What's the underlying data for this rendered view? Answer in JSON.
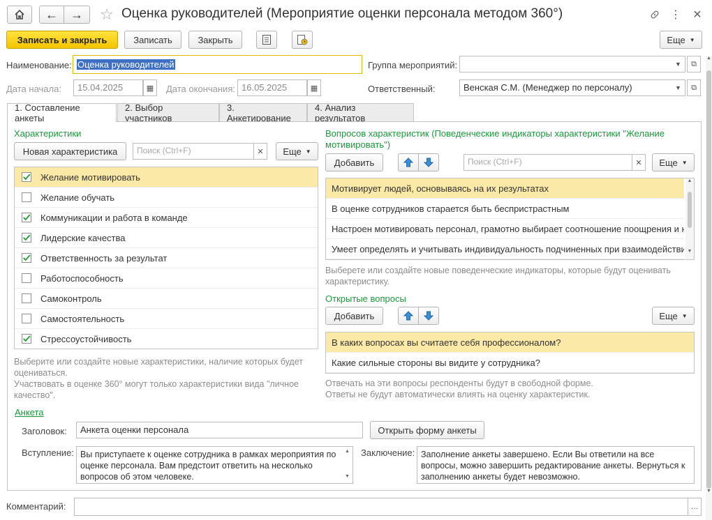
{
  "window": {
    "title": "Оценка руководителей (Мероприятие оценки персонала методом 360°)"
  },
  "toolbar": {
    "save_close": "Записать и закрыть",
    "save": "Записать",
    "close": "Закрыть",
    "more": "Еще"
  },
  "header": {
    "name_label": "Наименование:",
    "name_value": "Оценка руководителей",
    "group_label": "Группа мероприятий:",
    "group_value": "",
    "start_label": "Дата начала:",
    "start_value": "15.04.2025",
    "end_label": "Дата окончания:",
    "end_value": "16.05.2025",
    "resp_label": "Ответственный:",
    "resp_value": "Венская С.М. (Менеджер по персоналу)"
  },
  "tabs": [
    {
      "label": "1. Составление анкеты"
    },
    {
      "label": "2. Выбор участников"
    },
    {
      "label": "3. Анкетирование"
    },
    {
      "label": "4. Анализ результатов"
    }
  ],
  "chars": {
    "title": "Характеристики",
    "new_button": "Новая характеристика",
    "search_placeholder": "Поиск (Ctrl+F)",
    "more": "Еще",
    "items": [
      {
        "label": "Желание мотивировать",
        "checked": true
      },
      {
        "label": "Желание обучать",
        "checked": false
      },
      {
        "label": "Коммуникации и работа в команде",
        "checked": true
      },
      {
        "label": "Лидерские качества",
        "checked": true
      },
      {
        "label": "Ответственность за результат",
        "checked": true
      },
      {
        "label": "Работоспособность",
        "checked": false
      },
      {
        "label": "Самоконтроль",
        "checked": false
      },
      {
        "label": "Самостоятельность",
        "checked": false
      },
      {
        "label": "Стрессоустойчивость",
        "checked": true
      }
    ],
    "hint1": "Выберите или создайте новые характеристики, наличие которых будет оцениваться.",
    "hint2": "Участвовать в оценке 360° могут только характеристики вида \"личное качество\"."
  },
  "indicators": {
    "title": "Вопросов характеристик (Поведенческие индикаторы характеристики \"Желание мотивировать\")",
    "add": "Добавить",
    "search_placeholder": "Поиск (Ctrl+F)",
    "more": "Еще",
    "items": [
      "Мотивирует людей, основываясь на их результатах",
      "В оценке сотрудников старается быть беспристрастным",
      "Настроен мотивировать персонал, грамотно выбирает соотношение поощрения и наказания",
      "Умеет определять и учитывать индивидуальность подчиненных при взаимодействии"
    ],
    "hint": "Выберете или создайте новые поведенческие индикаторы, которые будут оценивать характеристику."
  },
  "open_questions": {
    "title": "Открытые вопросы",
    "add": "Добавить",
    "more": "Еще",
    "items": [
      "В каких вопросах вы считаете себя профессионалом?",
      "Какие сильные стороны вы видите у сотрудника?"
    ],
    "hint1": "Отвечать на эти вопросы респонденты будут в свободной форме.",
    "hint2": "Ответы не будут автоматически влиять на оценку характеристик."
  },
  "survey": {
    "link": "Анкета",
    "heading_label": "Заголовок:",
    "heading_value": "Анкета оценки персонала",
    "open_form": "Открыть форму анкеты",
    "intro_label": "Вступление:",
    "intro_value": "Вы приступаете к оценке сотрудника в рамках мероприятия по оценке персонала. Вам предстоит ответить на несколько вопросов об этом человеке.",
    "conclusion_label": "Заключение:",
    "conclusion_value": "Заполнение анкеты завершено. Если Вы ответили на все вопросы, можно завершить редактирование анкеты. Вернуться к заполнению анкеты будет невозможно."
  },
  "comment": {
    "label": "Комментарий:",
    "value": ""
  },
  "colors": {
    "accent_yellow": "#f4c400",
    "selection": "#fbe9a8",
    "green_title": "#1a9a3a",
    "checkmark": "#2a9a3a"
  }
}
